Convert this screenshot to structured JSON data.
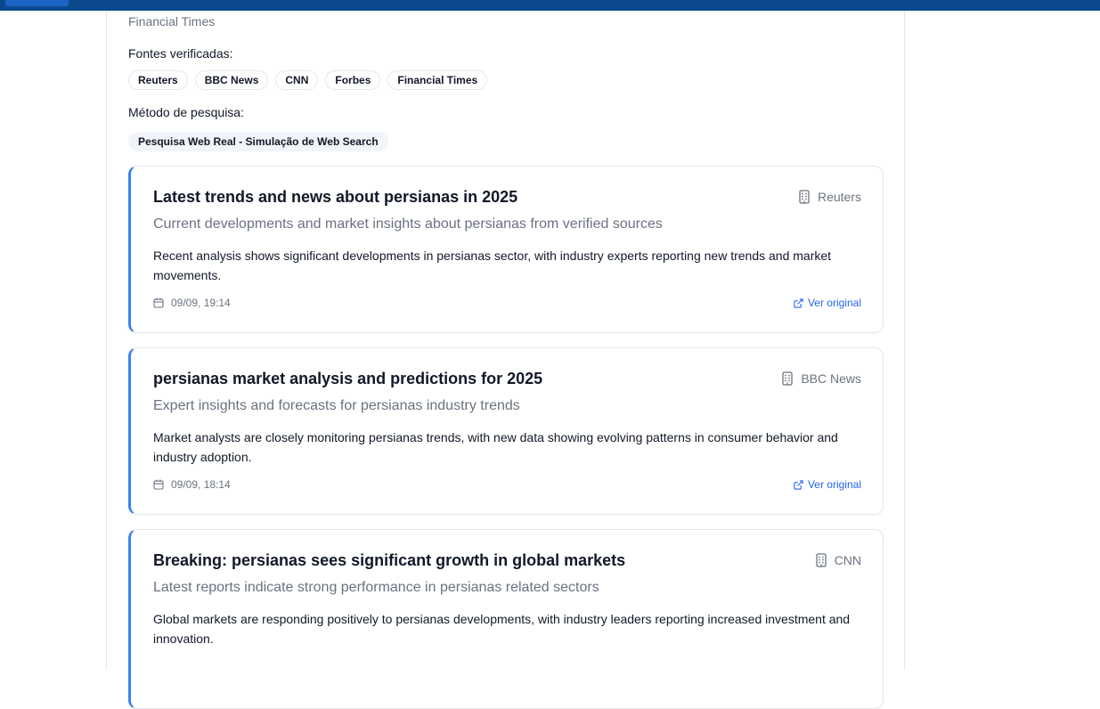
{
  "header": {
    "cutoff_text": "Financial Times"
  },
  "sources": {
    "label": "Fontes verificadas:",
    "items": [
      "Reuters",
      "BBC News",
      "CNN",
      "Forbes",
      "Financial Times"
    ]
  },
  "method": {
    "label": "Método de pesquisa:",
    "value": "Pesquisa Web Real - Simulação de Web Search"
  },
  "articles": [
    {
      "title": "Latest trends and news about persianas in 2025",
      "source": "Reuters",
      "subtitle": "Current developments and market insights about persianas from verified sources",
      "body": "Recent analysis shows significant developments in persianas sector, with industry experts reporting new trends and market movements.",
      "date": "09/09, 19:14",
      "link_label": "Ver original"
    },
    {
      "title": "persianas market analysis and predictions for 2025",
      "source": "BBC News",
      "subtitle": "Expert insights and forecasts for persianas industry trends",
      "body": "Market analysts are closely monitoring persianas trends, with new data showing evolving patterns in consumer behavior and industry adoption.",
      "date": "09/09, 18:14",
      "link_label": "Ver original"
    },
    {
      "title": "Breaking: persianas sees significant growth in global markets",
      "source": "CNN",
      "subtitle": "Latest reports indicate strong performance in persianas related sectors",
      "body": "Global markets are responding positively to persianas developments, with industry leaders reporting increased investment and innovation.",
      "date": "",
      "link_label": ""
    }
  ],
  "colors": {
    "accent": "#3b82f6",
    "link": "#2563eb",
    "topbar": "#0a4a8c"
  },
  "icons": {
    "source": "building-icon",
    "date": "calendar-icon",
    "link": "external-link-icon"
  }
}
